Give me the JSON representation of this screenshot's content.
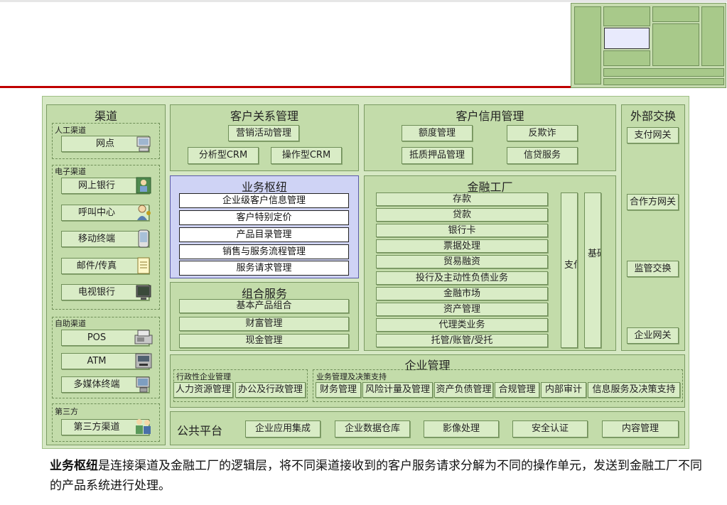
{
  "channels": {
    "title": "渠道",
    "manual": {
      "label": "人工渠道",
      "items": [
        "网点"
      ]
    },
    "electronic": {
      "label": "电子渠道",
      "items": [
        "网上银行",
        "呼叫中心",
        "移动终端",
        "邮件/传真",
        "电视银行"
      ]
    },
    "self_service": {
      "label": "自助渠道",
      "items": [
        "POS",
        "ATM",
        "多媒体终端"
      ]
    },
    "third_party": {
      "label": "第三方",
      "items": [
        "第三方渠道"
      ]
    }
  },
  "crm": {
    "title": "客户关系管理",
    "items": [
      "营销活动管理",
      "分析型CRM",
      "操作型CRM"
    ]
  },
  "hub": {
    "title": "业务枢纽",
    "items": [
      "企业级客户信息管理",
      "客户特别定价",
      "产品目录管理",
      "销售与服务流程管理",
      "服务请求管理"
    ]
  },
  "combo": {
    "title": "组合服务",
    "items": [
      "基本产品组合",
      "财富管理",
      "现金管理"
    ]
  },
  "credit": {
    "title": "客户信用管理",
    "items": [
      "额度管理",
      "反欺诈",
      "抵质押品管理",
      "信贷服务"
    ]
  },
  "factory": {
    "title": "金融工厂",
    "items": [
      "存款",
      "贷款",
      "银行卡",
      "票据处理",
      "贸易融资",
      "投行及主动性负债业务",
      "金融市场",
      "资产管理",
      "代理类业务",
      "托管/账管/受托"
    ],
    "payment": "支付",
    "basic": "基础服务"
  },
  "external": {
    "title": "外部交换",
    "items": [
      "支付网关",
      "合作方网关",
      "监管交换",
      "企业网关"
    ]
  },
  "enterprise": {
    "title": "企业管理",
    "admin": {
      "label": "行政性企业管理",
      "items": [
        "人力资源管理",
        "办公及行政管理"
      ]
    },
    "decision": {
      "label": "业务管理及决策支持",
      "items": [
        "财务管理",
        "风险计量及管理",
        "资产负债管理",
        "合规管理",
        "内部审计",
        "信息服务及决策支持"
      ]
    }
  },
  "platform": {
    "title": "公共平台",
    "items": [
      "企业应用集成",
      "企业数据仓库",
      "影像处理",
      "安全认证",
      "内容管理"
    ]
  },
  "caption": {
    "bold": "业务枢纽",
    "text": "是连接渠道及金融工厂的逻辑层，将不同渠道接收到的客户服务请求分解为不同的操作单元，发送到金融工厂不同的产品系统进行处理。"
  },
  "colors": {
    "panel": "#c3dcaa",
    "button": "#d9ecc6",
    "hub": "#cfd3f5",
    "accent_line": "#c00000"
  }
}
